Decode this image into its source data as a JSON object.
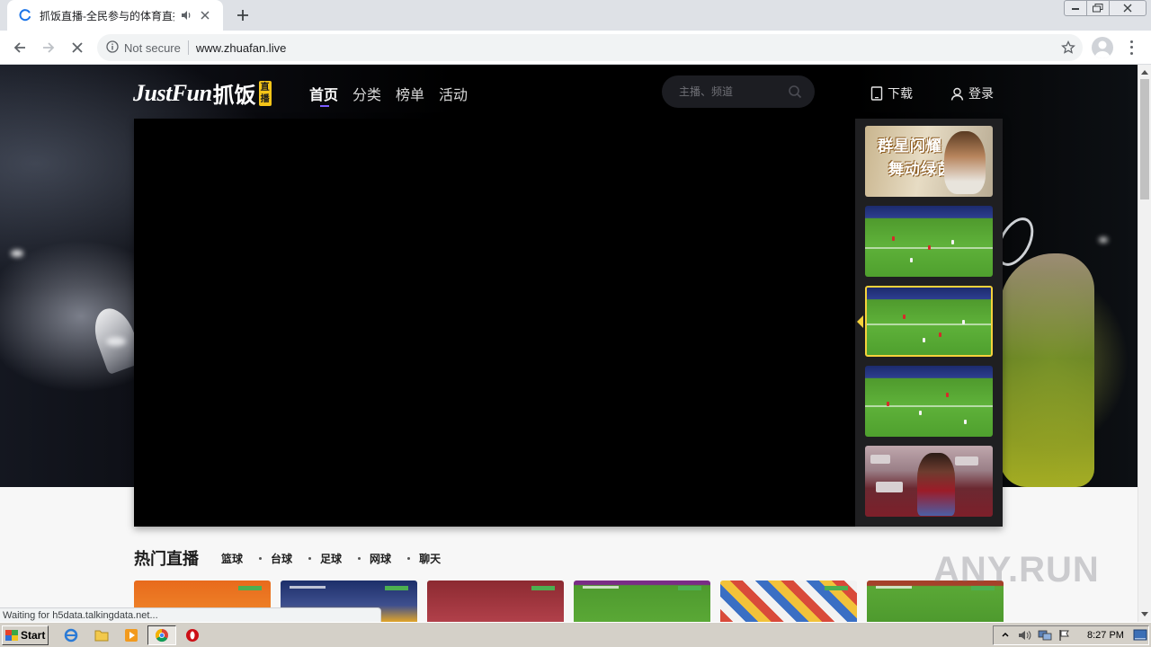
{
  "browser": {
    "tab_title": "抓饭直播-全民参与的体育直播",
    "security_label": "Not secure",
    "url": "www.zhuafan.live",
    "status_text": "Waiting for h5data.talkingdata.net..."
  },
  "site": {
    "logo_en": "JustFun",
    "logo_cn": "抓饭",
    "logo_badge": "直播",
    "nav": [
      {
        "label": "首页",
        "active": true
      },
      {
        "label": "分类",
        "active": false
      },
      {
        "label": "榜单",
        "active": false
      },
      {
        "label": "活动",
        "active": false
      }
    ],
    "search_placeholder": "主播、频道",
    "download_label": "下载",
    "login_label": "登录"
  },
  "player": {
    "promo_line1": "群星闪耀",
    "promo_line2": "舞动绿茵"
  },
  "hot": {
    "heading": "热门直播",
    "categories": [
      "篮球",
      "台球",
      "足球",
      "网球",
      "聊天"
    ]
  },
  "watermark": "ANY.RUN",
  "taskbar": {
    "start_label": "Start",
    "clock": "8:27 PM"
  },
  "colors": {
    "accent_nav": "#7b5bff",
    "thumb_highlight": "#f6d23b",
    "logo_badge_bg": "#f5c518"
  }
}
